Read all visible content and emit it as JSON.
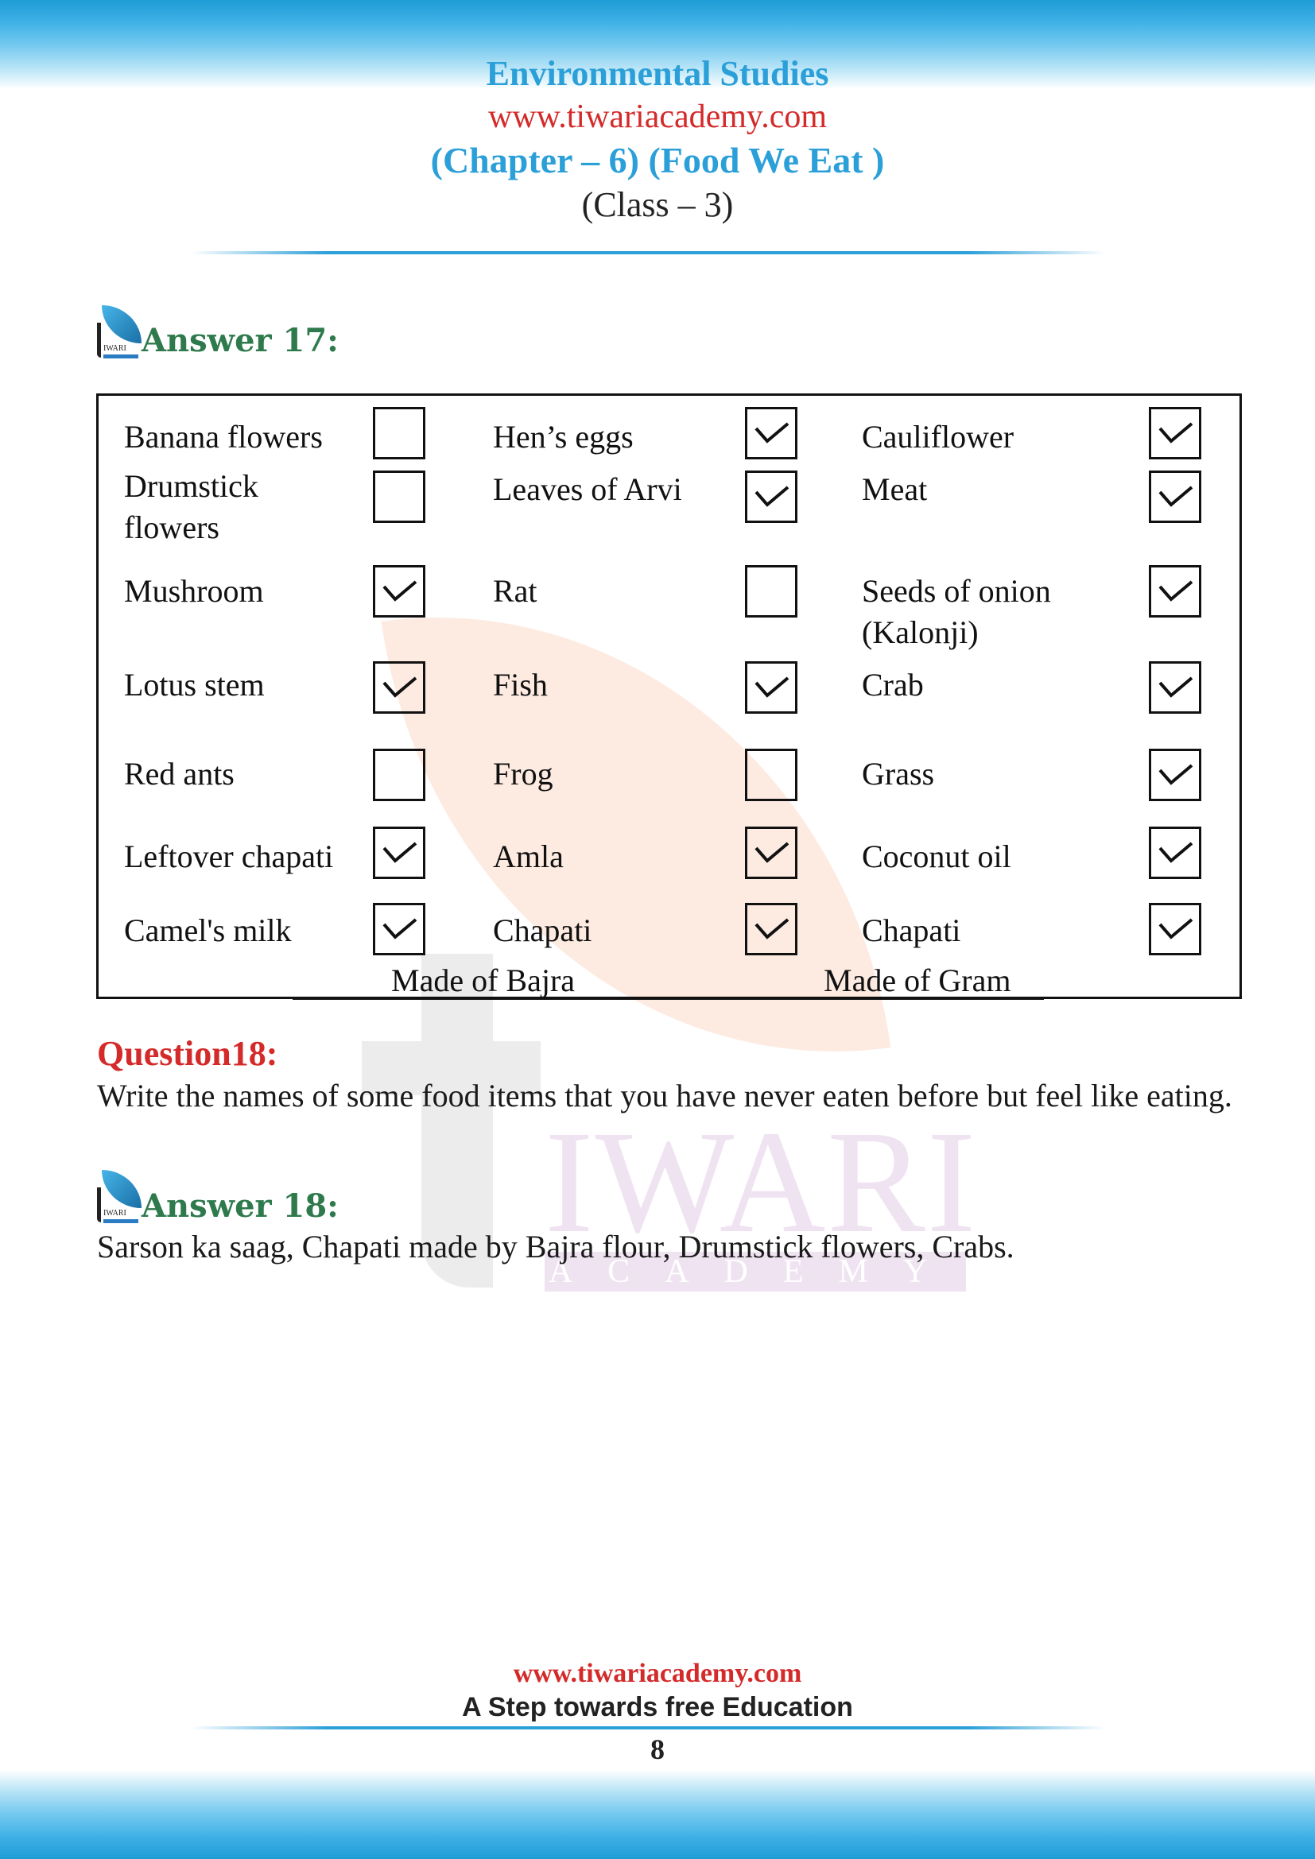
{
  "header": {
    "subject": "Environmental Studies",
    "website": "www.tiwariacademy.com",
    "chapter": "(Chapter – 6) (Food We Eat )",
    "class": "(Class – 3)"
  },
  "watermark": {
    "brand": "IWARI",
    "sub": "ACADEMY"
  },
  "logo": {
    "text": "IWARI"
  },
  "answer17": {
    "heading": "Answer 17:",
    "columns": [
      {
        "items": [
          {
            "label": "Banana flowers",
            "checked": false
          },
          {
            "label": "Drumstick\nflowers",
            "checked": false
          },
          {
            "label": "Mushroom",
            "checked": true
          },
          {
            "label": "Lotus stem",
            "checked": true
          },
          {
            "label": "Red ants",
            "checked": false
          },
          {
            "label": "Leftover chapati",
            "checked": true
          },
          {
            "label": "Camel's milk",
            "checked": true
          }
        ]
      },
      {
        "items": [
          {
            "label": "Hen’s eggs",
            "checked": true
          },
          {
            "label": "Leaves of Arvi",
            "checked": true
          },
          {
            "label": "Rat",
            "checked": false
          },
          {
            "label": "Fish",
            "checked": true
          },
          {
            "label": "Frog",
            "checked": false
          },
          {
            "label": "Amla",
            "checked": true
          },
          {
            "label": "Chapati",
            "checked": true
          }
        ],
        "footnote": "Made of Bajra"
      },
      {
        "items": [
          {
            "label": "Cauliflower",
            "checked": true
          },
          {
            "label": "Meat",
            "checked": true
          },
          {
            "label": "Seeds of onion\n(Kalonji)",
            "checked": true
          },
          {
            "label": "Crab",
            "checked": true
          },
          {
            "label": "Grass",
            "checked": true
          },
          {
            "label": "Coconut oil",
            "checked": true
          },
          {
            "label": "Chapati",
            "checked": true
          }
        ],
        "footnote": "Made of Gram"
      }
    ]
  },
  "question18": {
    "heading": "Question18:",
    "text": "Write the names of some food items that you have never eaten before but feel like eating."
  },
  "answer18": {
    "heading": "Answer 18:",
    "text": "Sarson ka saag, Chapati made by Bajra flour, Drumstick flowers, Crabs."
  },
  "footer": {
    "website": "www.tiwariacademy.com",
    "tagline": "A Step towards free Education",
    "page_number": "8"
  }
}
